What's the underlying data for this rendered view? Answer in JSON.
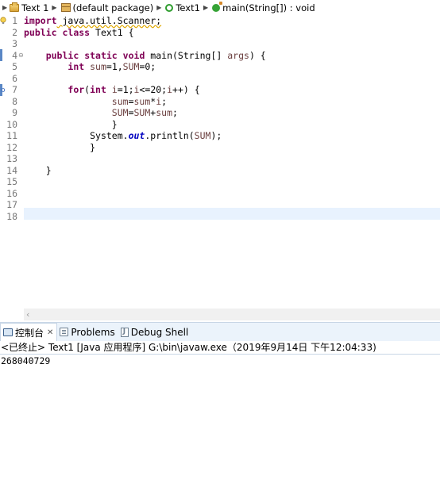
{
  "breadcrumb": {
    "project": "Text 1",
    "package": "(default package)",
    "class": "Text1",
    "method": "main(String[]) : void"
  },
  "editor": {
    "line_numbers": [
      "1",
      "2",
      "3",
      "4",
      "5",
      "6",
      "7",
      "8",
      "9",
      "10",
      "11",
      "12",
      "13",
      "14",
      "15",
      "16",
      "17",
      "18"
    ],
    "code": {
      "l1_kw": "import",
      "l1_rest": " java.util.Scanner;",
      "l2_kw1": "public",
      "l2_kw2": "class",
      "l2_rest": " Text1 {",
      "l4_indent": "    ",
      "l4_kw1": "public",
      "l4_kw2": "static",
      "l4_kw3": "void",
      "l4_mid": " main(String[] ",
      "l4_param": "args",
      "l4_end": ") {",
      "l5_indent": "        ",
      "l5_kw": "int",
      "l5_sp": " ",
      "l5_v1": "sum",
      "l5_mid": "=1,",
      "l5_v2": "SUM",
      "l5_end": "=0;",
      "l7_indent": "        ",
      "l7_kw1": "for",
      "l7_open": "(",
      "l7_kw2": "int",
      "l7_sp": " ",
      "l7_v1": "i",
      "l7_a": "=1;",
      "l7_v2": "i",
      "l7_b": "<=20;",
      "l7_v3": "i",
      "l7_c": "++) {",
      "l8_indent": "                ",
      "l8_v1": "sum",
      "l8_a": "=",
      "l8_v2": "sum",
      "l8_b": "*",
      "l8_v3": "i",
      "l8_c": ";",
      "l9_indent": "                ",
      "l9_v1": "SUM",
      "l9_a": "=",
      "l9_v2": "SUM",
      "l9_b": "+",
      "l9_v3": "sum",
      "l9_c": ";",
      "l10": "                }",
      "l11_indent": "            ",
      "l11_a": "System.",
      "l11_field": "out",
      "l11_b": ".println(",
      "l11_v": "SUM",
      "l11_c": ");",
      "l12": "            }",
      "l14": "    }"
    }
  },
  "console": {
    "tabs": [
      {
        "label": "控制台",
        "close": "✕"
      },
      {
        "label": "Problems"
      },
      {
        "label": "Debug Shell"
      }
    ],
    "header": "<已终止> Text1 [Java 应用程序] G:\\bin\\javaw.exe（2019年9月14日 下午12:04:33)",
    "output": "268040729"
  },
  "icons": {
    "breadcrumb_sep": "chevron-right-icon",
    "scroll_left": "chevron-left-icon"
  }
}
